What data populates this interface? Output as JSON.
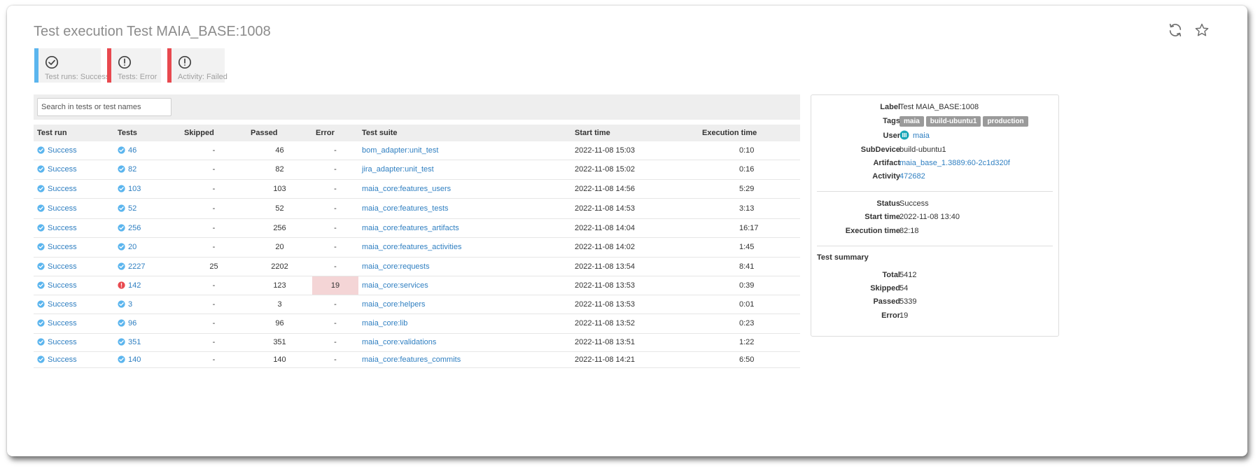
{
  "page": {
    "title": "Test execution Test MAIA_BASE:1008"
  },
  "status_cards": [
    {
      "label": "Test runs: Success",
      "icon": "check-circle-icon",
      "color": "#5bb5ee"
    },
    {
      "label": "Tests: Error",
      "icon": "exclamation-circle-icon",
      "color": "#e8494f"
    },
    {
      "label": "Activity: Failed",
      "icon": "exclamation-circle-icon",
      "color": "#e8494f"
    }
  ],
  "search": {
    "placeholder": "Search in tests or test names"
  },
  "table": {
    "headers": [
      "Test run",
      "Tests",
      "Skipped",
      "Passed",
      "Error",
      "Test suite",
      "Start time",
      "Execution time"
    ],
    "rows": [
      {
        "run": "Success",
        "tests": "46",
        "tests_state": "ok",
        "skipped": "-",
        "passed": "46",
        "error": "-",
        "suite": "bom_adapter:unit_test",
        "start": "2022-11-08 15:03",
        "exec": "0:10"
      },
      {
        "run": "Success",
        "tests": "82",
        "tests_state": "ok",
        "skipped": "-",
        "passed": "82",
        "error": "-",
        "suite": "jira_adapter:unit_test",
        "start": "2022-11-08 15:02",
        "exec": "0:16"
      },
      {
        "run": "Success",
        "tests": "103",
        "tests_state": "ok",
        "skipped": "-",
        "passed": "103",
        "error": "-",
        "suite": "maia_core:features_users",
        "start": "2022-11-08 14:56",
        "exec": "5:29"
      },
      {
        "run": "Success",
        "tests": "52",
        "tests_state": "ok",
        "skipped": "-",
        "passed": "52",
        "error": "-",
        "suite": "maia_core:features_tests",
        "start": "2022-11-08 14:53",
        "exec": "3:13"
      },
      {
        "run": "Success",
        "tests": "256",
        "tests_state": "ok",
        "skipped": "-",
        "passed": "256",
        "error": "-",
        "suite": "maia_core:features_artifacts",
        "start": "2022-11-08 14:04",
        "exec": "16:17"
      },
      {
        "run": "Success",
        "tests": "20",
        "tests_state": "ok",
        "skipped": "-",
        "passed": "20",
        "error": "-",
        "suite": "maia_core:features_activities",
        "start": "2022-11-08 14:02",
        "exec": "1:45"
      },
      {
        "run": "Success",
        "tests": "2227",
        "tests_state": "ok",
        "skipped": "25",
        "passed": "2202",
        "error": "-",
        "suite": "maia_core:requests",
        "start": "2022-11-08 13:54",
        "exec": "8:41"
      },
      {
        "run": "Success",
        "tests": "142",
        "tests_state": "error",
        "skipped": "-",
        "passed": "123",
        "error": "19",
        "suite": "maia_core:services",
        "start": "2022-11-08 13:53",
        "exec": "0:39"
      },
      {
        "run": "Success",
        "tests": "3",
        "tests_state": "ok",
        "skipped": "-",
        "passed": "3",
        "error": "-",
        "suite": "maia_core:helpers",
        "start": "2022-11-08 13:53",
        "exec": "0:01"
      },
      {
        "run": "Success",
        "tests": "96",
        "tests_state": "ok",
        "skipped": "-",
        "passed": "96",
        "error": "-",
        "suite": "maia_core:lib",
        "start": "2022-11-08 13:52",
        "exec": "0:23"
      },
      {
        "run": "Success",
        "tests": "351",
        "tests_state": "ok",
        "skipped": "-",
        "passed": "351",
        "error": "-",
        "suite": "maia_core:validations",
        "start": "2022-11-08 13:51",
        "exec": "1:22"
      },
      {
        "run": "Success",
        "tests": "140",
        "tests_state": "ok",
        "skipped": "-",
        "passed": "140",
        "error": "-",
        "suite": "maia_core:features_commits",
        "start": "2022-11-08 14:21",
        "exec": "6:50"
      }
    ]
  },
  "info": {
    "label_key": "Label",
    "label": "Test MAIA_BASE:1008",
    "tags_key": "Tags",
    "tags": [
      "maia",
      "build-ubuntu1",
      "production"
    ],
    "user_key": "User",
    "user": "maia",
    "subdevice_key": "SubDevice",
    "subdevice": "build-ubuntu1",
    "artifact_key": "Artifact",
    "artifact": "maia_base_1.3889:60-2c1d320f",
    "activity_key": "Activity",
    "activity": "472682",
    "status_key": "Status",
    "status": "Success",
    "start_key": "Start time",
    "start": "2022-11-08 13:40",
    "exec_key": "Execution time",
    "exec": "82:18",
    "summary_title": "Test summary",
    "total_key": "Total",
    "total": "5412",
    "skipped_key": "Skipped",
    "skipped": "54",
    "passed_key": "Passed",
    "passed": "5339",
    "error_key": "Error",
    "error": "19"
  },
  "colors": {
    "link": "#2f7fc1",
    "success": "#5bb5ee",
    "error": "#e8494f",
    "error_cell": "#f4d5d6"
  }
}
